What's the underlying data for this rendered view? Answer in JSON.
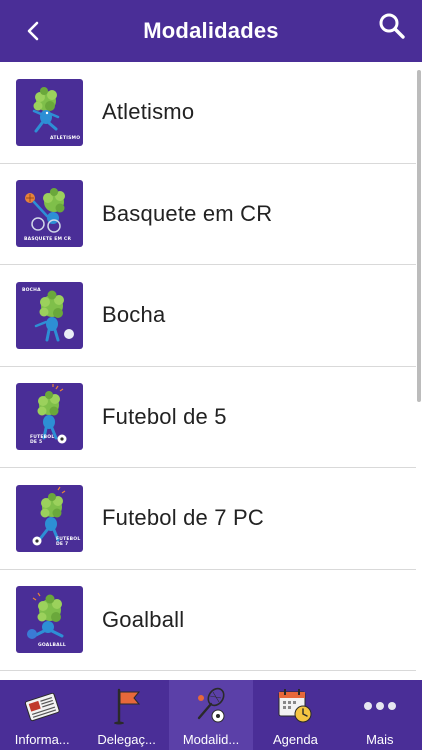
{
  "header": {
    "title": "Modalidades"
  },
  "list": {
    "items": [
      {
        "label": "Atletismo",
        "caption": "ATLETISMO"
      },
      {
        "label": "Basquete em CR",
        "caption": "BASQUETE EM CR"
      },
      {
        "label": "Bocha",
        "caption": "BOCHA"
      },
      {
        "label": "Futebol de 5",
        "caption": "FUTEBOL\nDE 5"
      },
      {
        "label": "Futebol de 7 PC",
        "caption": "FUTEBOL\nDE 7"
      },
      {
        "label": "Goalball",
        "caption": "GOALBALL"
      }
    ]
  },
  "tabbar": {
    "tabs": [
      {
        "label": "Informa...",
        "icon": "newspaper-icon"
      },
      {
        "label": "Delegaç...",
        "icon": "flag-icon"
      },
      {
        "label": "Modalid...",
        "icon": "sports-icon",
        "active": true
      },
      {
        "label": "Agenda",
        "icon": "calendar-clock-icon"
      },
      {
        "label": "Mais",
        "icon": "more-icon"
      }
    ]
  },
  "colors": {
    "brand": "#4a2e97",
    "active_tab": "#5b40a8",
    "mascot_leaves": "#7fbf4a",
    "mascot_body": "#2d8fd5"
  }
}
